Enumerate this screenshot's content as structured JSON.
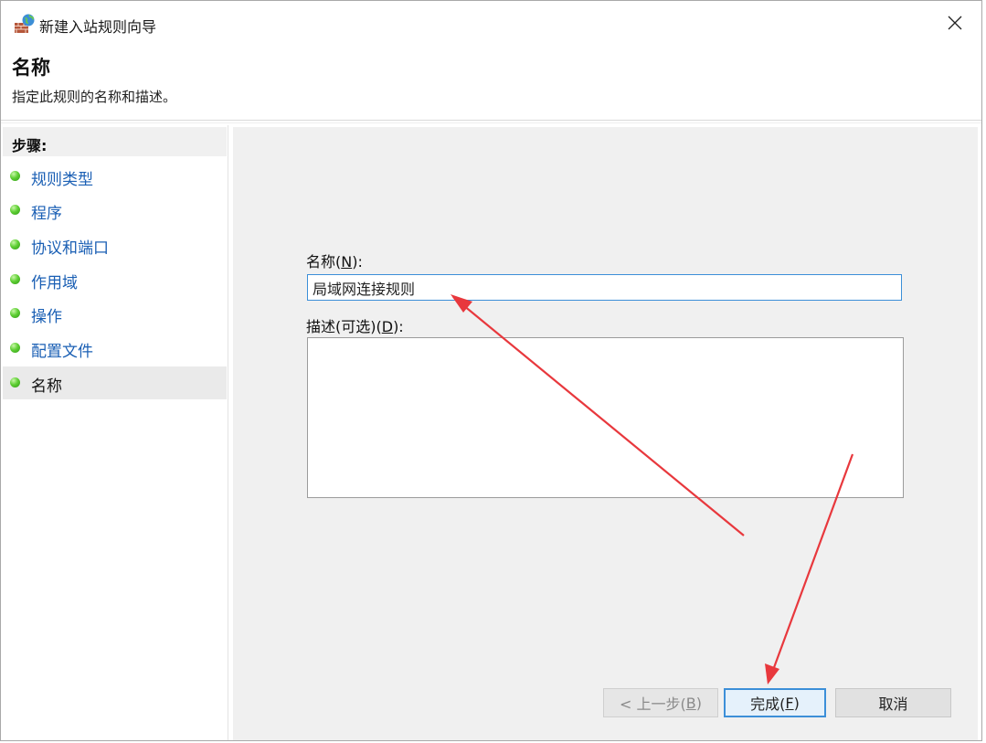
{
  "window": {
    "title": "新建入站规则向导"
  },
  "header": {
    "title": "名称",
    "description": "指定此规则的名称和描述。"
  },
  "sidebar": {
    "title": "步骤:",
    "items": [
      {
        "label": "规则类型",
        "active": false
      },
      {
        "label": "程序",
        "active": false
      },
      {
        "label": "协议和端口",
        "active": false
      },
      {
        "label": "作用域",
        "active": false
      },
      {
        "label": "操作",
        "active": false
      },
      {
        "label": "配置文件",
        "active": false
      },
      {
        "label": "名称",
        "active": true
      }
    ]
  },
  "form": {
    "name_label_text": "名称(",
    "name_label_key": "N",
    "name_label_end": "):",
    "name_value": "局域网连接规则",
    "desc_label_text": "描述(可选)(",
    "desc_label_key": "D",
    "desc_label_end": "):",
    "desc_value": ""
  },
  "buttons": {
    "back_text": "< 上一步(",
    "back_key": "B",
    "back_end": ")",
    "finish_text": "完成(",
    "finish_key": "F",
    "finish_end": ")",
    "cancel": "取消"
  },
  "colors": {
    "link": "#1a5fb4",
    "focus_border": "#3c8fd8",
    "annotation_arrow": "#e8383d",
    "step_dot": "#5fcf34"
  },
  "icons": {
    "title_icon": "firewall-globe-icon",
    "close_icon": "close-icon",
    "step_icon": "green-dot-icon"
  }
}
